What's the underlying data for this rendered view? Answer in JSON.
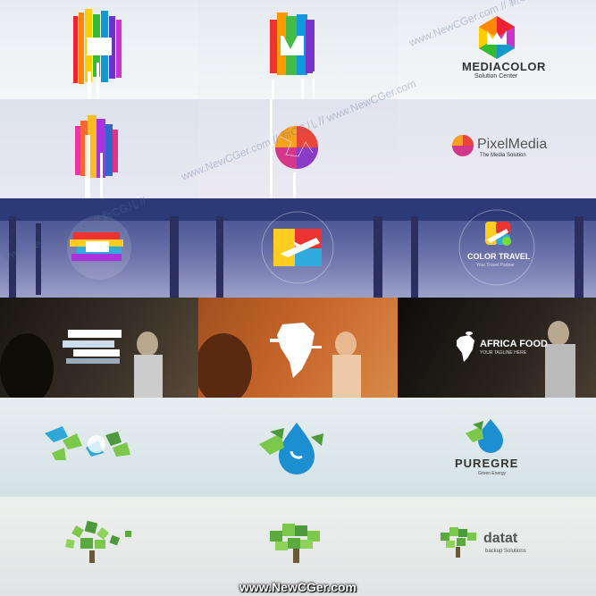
{
  "gallery": {
    "rows": [
      {
        "theme": "light",
        "cells": [
          {
            "brand": "",
            "tagline": ""
          },
          {
            "brand": "",
            "tagline": ""
          },
          {
            "brand": "MEDIACOLOR",
            "tagline": "Solution Center"
          }
        ]
      },
      {
        "theme": "light",
        "cells": [
          {
            "brand": "",
            "tagline": ""
          },
          {
            "brand": "",
            "tagline": ""
          },
          {
            "brand": "PixelMedia",
            "tagline": "The Media Solution"
          }
        ]
      },
      {
        "theme": "corridor",
        "cells": [
          {
            "brand": "",
            "tagline": ""
          },
          {
            "brand": "",
            "tagline": ""
          },
          {
            "brand": "COLOR TRAVEL",
            "tagline": "Your Travel Partner"
          }
        ]
      },
      {
        "theme": "dark",
        "cells": [
          {
            "brand": "",
            "tagline": ""
          },
          {
            "brand": "",
            "tagline": ""
          },
          {
            "brand": "AFRICA FOOD",
            "tagline": "YOUR TAGLINE HERE"
          }
        ]
      },
      {
        "theme": "ice",
        "cells": [
          {
            "brand": "",
            "tagline": ""
          },
          {
            "brand": "",
            "tagline": ""
          },
          {
            "brand": "PUREGRE",
            "tagline": "Green Energy"
          }
        ]
      },
      {
        "theme": "ice",
        "cells": [
          {
            "brand": "",
            "tagline": ""
          },
          {
            "brand": "",
            "tagline": ""
          },
          {
            "brand": "datat",
            "tagline": "backup Solutions"
          }
        ]
      }
    ]
  },
  "watermark": {
    "text_1": "www.NewCGer.com // 新CG儿 // www.NewCGer.com",
    "text_2": "www.NewCGer.com // 新CG儿 // www.NewCGer.com",
    "text_3": "www.NewCGer.com // 新CG儿 //"
  },
  "footer": {
    "text": "www.NewCGer.com",
    "color": "#ffffff",
    "accent": "#3cff3c"
  }
}
